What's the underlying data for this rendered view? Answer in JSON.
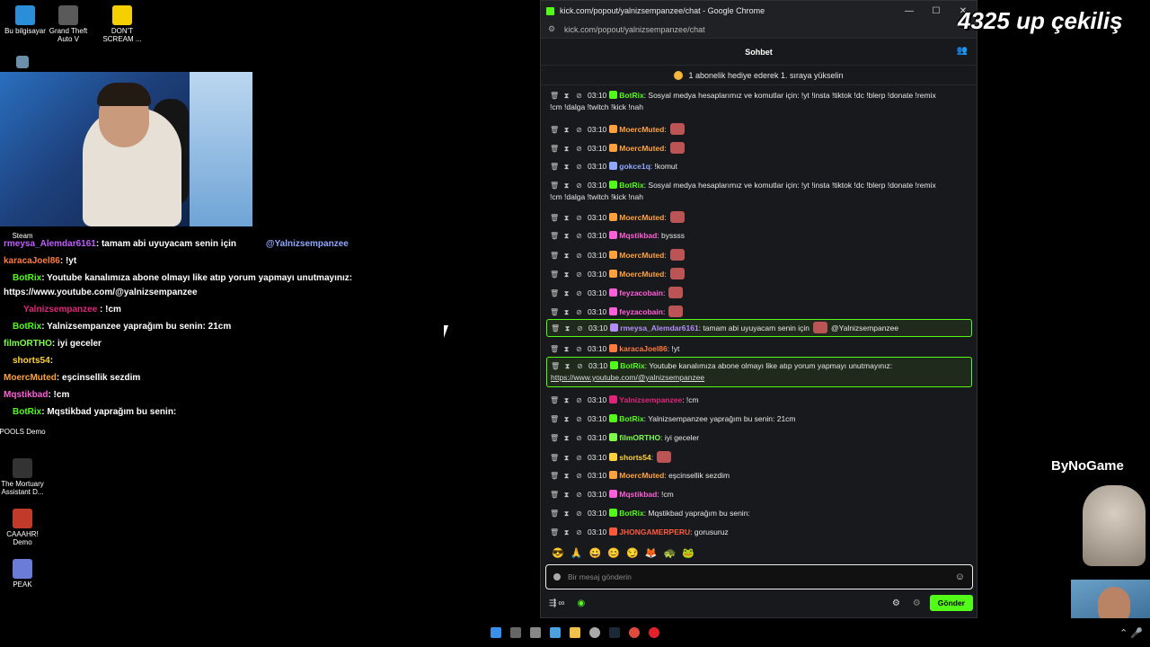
{
  "desktop": {
    "icons": [
      {
        "label": "Bu bilgisayar",
        "name": "pc-icon"
      },
      {
        "label": "Grand Theft Auto V",
        "name": "gta-icon"
      },
      {
        "label": "DON'T SCREAM ...",
        "name": "dont-scream-icon"
      },
      {
        "label": "Steam",
        "name": "steam-icon"
      },
      {
        "label": "POOLS Demo",
        "name": "pools-icon"
      },
      {
        "label": "The Mortuary Assistant D...",
        "name": "mortuary-icon"
      },
      {
        "label": "CAAAHR! Demo",
        "name": "caaahr-icon"
      },
      {
        "label": "PEAK",
        "name": "peak-icon"
      }
    ]
  },
  "stream_overlay": {
    "title_text": "4325 up çekiliş",
    "sponsor": "ByNoGame"
  },
  "obs_chat": [
    {
      "user": "rmeysa_Alemdar6161",
      "text": ": tamam abi uyuyacam senin için",
      "extra": "@Yalnizsempanzee",
      "color": "#c05cff"
    },
    {
      "user": "karacaJoel86",
      "text": ": !yt",
      "color": "#ff7a3d"
    },
    {
      "user": "BotRix",
      "text": ": Youtube kanalımıza abone olmayı like atıp yorum yapmayı unutmayınız:",
      "color": "#53fc18"
    },
    {
      "user": "",
      "text": "https://www.youtube.com/@yalnizsempanzee",
      "color": "#fff"
    },
    {
      "user": "Yalnizsempanzee",
      "text": " : !cm",
      "color": "#e0247a"
    },
    {
      "user": "BotRix",
      "text": ": Yalnizsempanzee yaprağım bu senin: 21cm",
      "color": "#53fc18"
    },
    {
      "user": "filmORTHO",
      "text": ": iyi geceler",
      "color": "#7dff4a"
    },
    {
      "user": "shorts54",
      "text": ":",
      "color": "#ffd23d"
    },
    {
      "user": "MoercMuted",
      "text": ": eşcinsellik sezdim",
      "color": "#ffa23d"
    },
    {
      "user": "Mqstikbad",
      "text": ": !cm",
      "color": "#ff5fd8"
    },
    {
      "user": "BotRix",
      "text": ": Mqstikbad yaprağım bu senin:",
      "color": "#53fc18"
    }
  ],
  "browser": {
    "window_title": "kick.com/popout/yalnizsempanzee/chat - Google Chrome",
    "url": "kick.com/popout/yalnizsempanzee/chat",
    "minimize": "—",
    "maximize": "☐",
    "close": "✕"
  },
  "chat": {
    "header": "Sohbet",
    "sub_banner": "1 abonelik hediye ederek 1. sıraya yükselin",
    "messages": [
      {
        "time": "03:10",
        "user": "BotRix",
        "color": "#53fc18",
        "text": ": Sosyal medya hesaplarımız ve komutlar için: !yt !insta !tiktok !dc !blerp !donate !remix",
        "text2": "!cm !dalga !twitch !kick !nah"
      },
      {
        "time": "03:10",
        "user": "MoercMuted",
        "color": "#ffa23d",
        "text": ":"
      },
      {
        "time": "03:10",
        "user": "MoercMuted",
        "color": "#ffa23d",
        "text": ":"
      },
      {
        "time": "03:10",
        "user": "gokce1q",
        "color": "#8fa8ff",
        "text": ": !komut"
      },
      {
        "time": "03:10",
        "user": "BotRix",
        "color": "#53fc18",
        "text": ": Sosyal medya hesaplarımız ve komutlar için: !yt !insta !tiktok !dc !blerp !donate !remix",
        "text2": "!cm !dalga !twitch !kick !nah"
      },
      {
        "time": "03:10",
        "user": "MoercMuted",
        "color": "#ffa23d",
        "text": ":"
      },
      {
        "time": "03:10",
        "user": "Mqstikbad",
        "color": "#ff5fd8",
        "text": ": byssss"
      },
      {
        "time": "03:10",
        "user": "MoercMuted",
        "color": "#ffa23d",
        "text": ":"
      },
      {
        "time": "03:10",
        "user": "MoercMuted",
        "color": "#ffa23d",
        "text": ":"
      },
      {
        "time": "03:10",
        "user": "feyzacobain",
        "color": "#ff5fd8",
        "text": ":"
      },
      {
        "time": "03:10",
        "user": "feyzacobain",
        "color": "#ff5fd8",
        "text": ":"
      },
      {
        "time": "03:10",
        "user": "rmeysa_Alemdar6161",
        "color": "#b58cff",
        "text": ": tamam abi uyuyacam senin için",
        "mention": "@Yalnizsempanzee"
      },
      {
        "time": "03:10",
        "user": "karacaJoel86",
        "color": "#ff7a3d",
        "text": ": !yt"
      },
      {
        "time": "03:10",
        "user": "BotRix",
        "color": "#53fc18",
        "text": ": Youtube kanalımıza abone olmayı like atıp yorum yapmayı unutmayınız:",
        "text2": "https://www.youtube.com/@yalnizsempanzee"
      },
      {
        "time": "03:10",
        "user": "Yalnizsempanzee",
        "color": "#e0247a",
        "text": ": !cm"
      },
      {
        "time": "03:10",
        "user": "BotRix",
        "color": "#53fc18",
        "text": ": Yalnizsempanzee yaprağım bu senin: 21cm"
      },
      {
        "time": "03:10",
        "user": "filmORTHO",
        "color": "#7dff4a",
        "text": ": iyi geceler"
      },
      {
        "time": "03:10",
        "user": "shorts54",
        "color": "#ffd23d",
        "text": ":"
      },
      {
        "time": "03:10",
        "user": "MoercMuted",
        "color": "#ffa23d",
        "text": ": eşcinsellik sezdim"
      },
      {
        "time": "03:10",
        "user": "Mqstikbad",
        "color": "#ff5fd8",
        "text": ": !cm"
      },
      {
        "time": "03:10",
        "user": "BotRix",
        "color": "#53fc18",
        "text": ": Mqstikbad yaprağım bu senin:"
      },
      {
        "time": "03:10",
        "user": "JHONGAMERPERU",
        "color": "#ff5a3d",
        "text": ": gorusuruz"
      }
    ],
    "input_placeholder": "Bir mesaj gönderin",
    "send_label": "Gönder",
    "infinity": "∞"
  }
}
